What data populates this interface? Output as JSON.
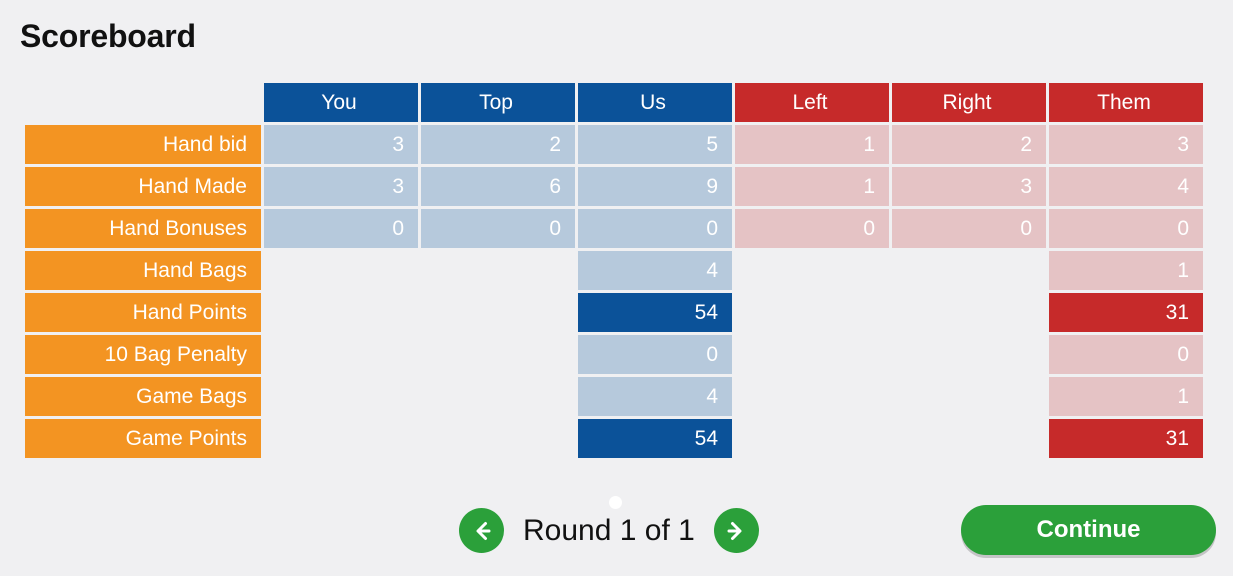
{
  "page_title": "Scoreboard",
  "colors": {
    "background": "#f0f0f2",
    "blue_header": "#0b5299",
    "blue_light": "#b6c9dc",
    "red_header": "#c62a2a",
    "red_light": "#e5c3c5",
    "orange_label": "#f39422",
    "green_accent": "#2ba03a",
    "title_text": "#111111"
  },
  "scoreboard": {
    "corner_label": "",
    "columns": [
      {
        "label": "You",
        "team": "blue"
      },
      {
        "label": "Top",
        "team": "blue"
      },
      {
        "label": "Us",
        "team": "blue"
      },
      {
        "label": "Left",
        "team": "red"
      },
      {
        "label": "Right",
        "team": "red"
      },
      {
        "label": "Them",
        "team": "red"
      }
    ],
    "rows": [
      {
        "label": "Hand bid",
        "cells": [
          {
            "value": "3",
            "style": "blue-light"
          },
          {
            "value": "2",
            "style": "blue-light"
          },
          {
            "value": "5",
            "style": "blue-light"
          },
          {
            "value": "1",
            "style": "red-light"
          },
          {
            "value": "2",
            "style": "red-light"
          },
          {
            "value": "3",
            "style": "red-light"
          }
        ]
      },
      {
        "label": "Hand Made",
        "cells": [
          {
            "value": "3",
            "style": "blue-light"
          },
          {
            "value": "6",
            "style": "blue-light"
          },
          {
            "value": "9",
            "style": "blue-light"
          },
          {
            "value": "1",
            "style": "red-light"
          },
          {
            "value": "3",
            "style": "red-light"
          },
          {
            "value": "4",
            "style": "red-light"
          }
        ]
      },
      {
        "label": "Hand Bonuses",
        "cells": [
          {
            "value": "0",
            "style": "blue-light"
          },
          {
            "value": "0",
            "style": "blue-light"
          },
          {
            "value": "0",
            "style": "blue-light"
          },
          {
            "value": "0",
            "style": "red-light"
          },
          {
            "value": "0",
            "style": "red-light"
          },
          {
            "value": "0",
            "style": "red-light"
          }
        ]
      },
      {
        "label": "Hand Bags",
        "cells": [
          {
            "value": "",
            "style": "empty"
          },
          {
            "value": "",
            "style": "empty"
          },
          {
            "value": "4",
            "style": "blue-light"
          },
          {
            "value": "",
            "style": "empty"
          },
          {
            "value": "",
            "style": "empty"
          },
          {
            "value": "1",
            "style": "red-light"
          }
        ]
      },
      {
        "label": "Hand Points",
        "cells": [
          {
            "value": "",
            "style": "empty"
          },
          {
            "value": "",
            "style": "empty"
          },
          {
            "value": "54",
            "style": "blue-dark"
          },
          {
            "value": "",
            "style": "empty"
          },
          {
            "value": "",
            "style": "empty"
          },
          {
            "value": "31",
            "style": "red-dark"
          }
        ]
      },
      {
        "label": "10 Bag Penalty",
        "cells": [
          {
            "value": "",
            "style": "empty"
          },
          {
            "value": "",
            "style": "empty"
          },
          {
            "value": "0",
            "style": "blue-light"
          },
          {
            "value": "",
            "style": "empty"
          },
          {
            "value": "",
            "style": "empty"
          },
          {
            "value": "0",
            "style": "red-light"
          }
        ]
      },
      {
        "label": "Game Bags",
        "cells": [
          {
            "value": "",
            "style": "empty"
          },
          {
            "value": "",
            "style": "empty"
          },
          {
            "value": "4",
            "style": "blue-light"
          },
          {
            "value": "",
            "style": "empty"
          },
          {
            "value": "",
            "style": "empty"
          },
          {
            "value": "1",
            "style": "red-light"
          }
        ]
      },
      {
        "label": "Game Points",
        "cells": [
          {
            "value": "",
            "style": "empty"
          },
          {
            "value": "",
            "style": "empty"
          },
          {
            "value": "54",
            "style": "blue-dark"
          },
          {
            "value": "",
            "style": "empty"
          },
          {
            "value": "",
            "style": "empty"
          },
          {
            "value": "31",
            "style": "red-dark"
          }
        ]
      }
    ]
  },
  "navigation": {
    "prev_icon": "arrow-left-icon",
    "next_icon": "arrow-right-icon",
    "round_label": "Round 1 of 1"
  },
  "continue_button": {
    "label": "Continue"
  }
}
